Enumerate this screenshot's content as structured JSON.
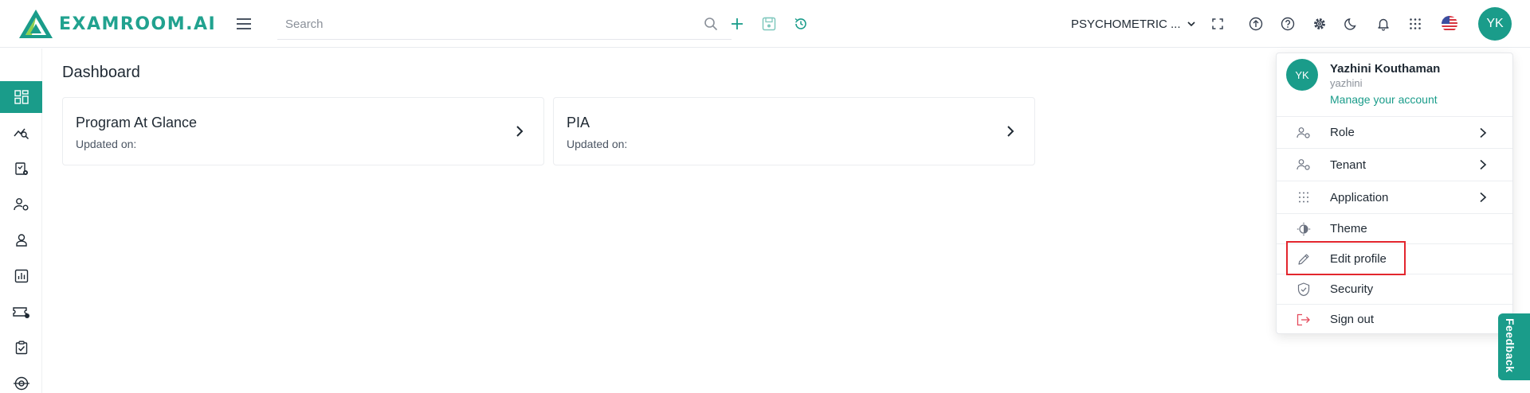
{
  "header": {
    "brand": "EXAMROOM.AI",
    "search_placeholder": "Search",
    "org_selector": "PSYCHOMETRIC ...",
    "avatar_initials": "YK"
  },
  "sidebar": {
    "items": [
      {
        "name": "dashboard",
        "icon": "dashboard-grid-icon",
        "active": true
      },
      {
        "name": "analytics",
        "icon": "chart-search-icon",
        "active": false
      },
      {
        "name": "exams",
        "icon": "clipboard-settings-icon",
        "active": false
      },
      {
        "name": "user-settings",
        "icon": "user-gear-icon",
        "active": false
      },
      {
        "name": "candidates",
        "icon": "user-icon",
        "active": false
      },
      {
        "name": "reports",
        "icon": "bar-chart-icon",
        "active": false
      },
      {
        "name": "vouchers",
        "icon": "ticket-icon",
        "active": false
      },
      {
        "name": "tasks",
        "icon": "clipboard-check-icon",
        "active": false
      },
      {
        "name": "other",
        "icon": "dial-icon",
        "active": false
      }
    ]
  },
  "main": {
    "title": "Dashboard",
    "cards": [
      {
        "title": "Program At Glance",
        "subtitle": "Updated on:"
      },
      {
        "title": "PIA",
        "subtitle": "Updated on:"
      }
    ]
  },
  "profile_menu": {
    "initials": "YK",
    "name": "Yazhini Kouthaman",
    "username": "yazhini",
    "manage_label": "Manage your account",
    "items": [
      {
        "label": "Role",
        "icon": "user-role-icon",
        "has_submenu": true
      },
      {
        "label": "Tenant",
        "icon": "tenant-icon",
        "has_submenu": true
      },
      {
        "label": "Application",
        "icon": "apps-grid-icon",
        "has_submenu": true
      },
      {
        "label": "Theme",
        "icon": "theme-icon",
        "has_submenu": false
      },
      {
        "label": "Edit profile",
        "icon": "pencil-icon",
        "has_submenu": false
      },
      {
        "label": "Security",
        "icon": "shield-check-icon",
        "has_submenu": false
      },
      {
        "label": "Sign out",
        "icon": "logout-icon",
        "has_submenu": false
      }
    ]
  },
  "feedback_label": "Feedback",
  "colors": {
    "brand": "#1a9c8a",
    "highlight": "#e3262e",
    "signout_icon": "#e4495b"
  }
}
